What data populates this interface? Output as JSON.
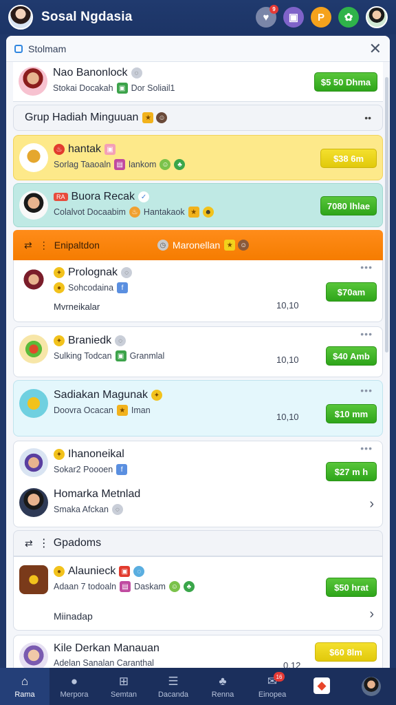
{
  "app": {
    "title": "Sosal Ngdasia"
  },
  "topbar": {
    "icons": [
      {
        "name": "notification-icon",
        "color": "#7a86a8",
        "glyph": "♥",
        "badge": "9"
      },
      {
        "name": "game-icon",
        "color": "#7f63c9",
        "glyph": "▣"
      },
      {
        "name": "chat-icon",
        "color": "#f5a21c",
        "glyph": "P"
      },
      {
        "name": "share-icon",
        "color": "#2fb34a",
        "glyph": "✿"
      }
    ]
  },
  "panel": {
    "title": "Stolmam"
  },
  "rows": {
    "r1": {
      "name": "Nao Banonlock",
      "sub_a": "Stokai Docakah",
      "sub_b": "Dor Soliail1",
      "button": "$5 50 Dhma"
    },
    "group1": {
      "title": "Grup Hadiah Minguuan"
    },
    "r2": {
      "name": "hantak",
      "sub_a": "Sorlag Taaoaln",
      "sub_b": "lankom",
      "button": "$38 6m"
    },
    "r3": {
      "badge": "RA",
      "name": "Buora Recak",
      "sub_a": "Colalvot Docaabim",
      "sub_b": "Hantakaok",
      "button": "7080 lhlae"
    },
    "orange": {
      "left": "Enipaltdon",
      "right": "Maronellan"
    },
    "r4": {
      "name": "Prolognak",
      "sub_a": "Sohcodaina",
      "extra": "Mvrneikalar",
      "time": "10,10",
      "button": "$70am"
    },
    "r5": {
      "name": "Braniedk",
      "sub_a": "Sulking Todcan",
      "sub_b": "Granmlal",
      "time": "10,10",
      "button": "$40 Amb"
    },
    "r6": {
      "name": "Sadiakan Magunak",
      "sub_a": "Doovra Ocacan",
      "sub_b": "Iman",
      "time": "10,10",
      "button": "$10 mm"
    },
    "r7": {
      "name": "Ihanoneikal",
      "sub_a": "Sokar2 Poooen",
      "button": "$27 m h"
    },
    "r8": {
      "name": "Homarka Metnlad",
      "sub_a": "Smaka Afckan"
    },
    "group2": {
      "title": "Gpadoms"
    },
    "r9": {
      "name": "Alaunieck",
      "sub_a": "Adaan 7 todoaln",
      "sub_b": "Daskam",
      "extra": "Miinadap",
      "button": "$50 hrat"
    },
    "r10": {
      "name": "Kile Derkan Manauan",
      "sub_a": "Adelan Sanalan Caranthal",
      "time": "0,12",
      "button": "$60 8lm"
    }
  },
  "bottom_nav": {
    "items": [
      {
        "label": "Rama",
        "icon": "home-icon",
        "glyph": "⌂",
        "active": true
      },
      {
        "label": "Merpora",
        "icon": "person-icon",
        "glyph": "●"
      },
      {
        "label": "Semtan",
        "icon": "gift-icon",
        "glyph": "⊞"
      },
      {
        "label": "Dacanda",
        "icon": "list-icon",
        "glyph": "☰"
      },
      {
        "label": "Renna",
        "icon": "group-icon",
        "glyph": "♣"
      },
      {
        "label": "Einopea",
        "icon": "mail-icon",
        "glyph": "✉",
        "badge": "16"
      },
      {
        "label": "",
        "icon": "app-icon",
        "glyph": "◆"
      },
      {
        "label": "",
        "icon": "profile-icon",
        "glyph": ""
      }
    ]
  }
}
